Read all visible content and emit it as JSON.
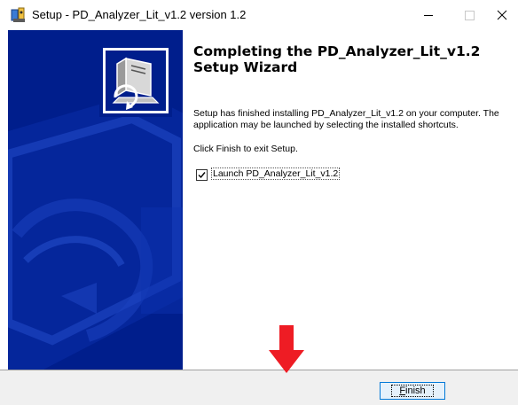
{
  "window": {
    "title": "Setup - PD_Analyzer_Lit_v1.2 version 1.2",
    "icon": "installer-icon",
    "controls": [
      "minimize-icon",
      "maximize-icon",
      "close-icon"
    ]
  },
  "side_panel": {
    "logo": "installer-computer-icon",
    "background_color": "#001e8c"
  },
  "content": {
    "heading": "Completing the PD_Analyzer_Lit_v1.2 Setup Wizard",
    "body": "Setup has finished installing PD_Analyzer_Lit_v1.2 on your computer. The application may be launched by selecting the installed shortcuts.",
    "exit_instruction": "Click Finish to exit Setup.",
    "launch_checkbox": {
      "label": "Launch PD_Analyzer_Lit_v1.2",
      "checked": true
    }
  },
  "footer": {
    "finish_label": "Finish",
    "finish_mnemonic": "F"
  },
  "annotation": {
    "type": "arrow-down",
    "color": "#ee1c24"
  }
}
